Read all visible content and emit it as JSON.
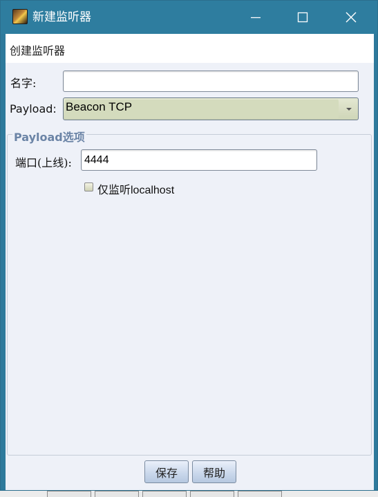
{
  "window": {
    "title": "新建监听器"
  },
  "header": {
    "text": "创建监听器"
  },
  "form": {
    "name_label": "名字:",
    "name_value": "",
    "payload_label": "Payload:",
    "payload_value": "Beacon TCP"
  },
  "options": {
    "legend": "Payload选项",
    "port_label": "端口(上线):",
    "port_value": "4444",
    "localhost_label": "仅监听localhost",
    "localhost_checked": false
  },
  "buttons": {
    "save": "保存",
    "help": "帮助"
  },
  "colors": {
    "titlebar": "#2e7d9f",
    "content_bg": "#eef1f8",
    "legend": "#6b84a6"
  },
  "icons": [
    "app-icon",
    "minimize-icon",
    "maximize-icon",
    "close-icon",
    "dropdown-arrow-icon",
    "checkbox-icon"
  ]
}
